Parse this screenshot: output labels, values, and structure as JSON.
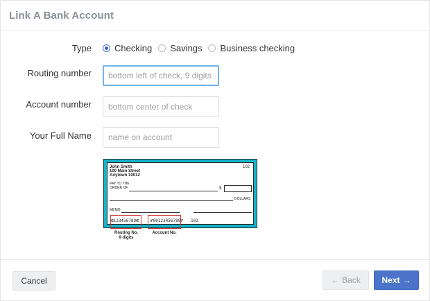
{
  "dialog": {
    "title": "Link A Bank Account"
  },
  "form": {
    "type_label": "Type",
    "type_options": [
      {
        "label": "Checking",
        "checked": true
      },
      {
        "label": "Savings",
        "checked": false
      },
      {
        "label": "Business checking",
        "checked": false
      }
    ],
    "routing_label": "Routing number",
    "routing_placeholder": "bottom left of check, 9 digits",
    "routing_value": "",
    "account_label": "Account number",
    "account_placeholder": "bottom center of check",
    "account_value": "",
    "name_label": "Your Full Name",
    "name_placeholder": "name on account",
    "name_value": ""
  },
  "check_image": {
    "owner_name": "John Smith",
    "address_line1": "100 Main Street",
    "address_line2": "Anytown 10012",
    "check_number": "102",
    "pay_to_line1": "PAY TO THE",
    "pay_to_line2": "ORDER OF",
    "dollar_sign": "$",
    "dollars": "DOLLARS",
    "memo": "MEMO",
    "micr_routing": "⑆123456789⑆",
    "micr_account": "⑈00123456789⑈",
    "micr_check": "102",
    "routing_caption_line1": "Routing No.",
    "routing_caption_line2": "9 digits",
    "account_caption": "Account No."
  },
  "footer": {
    "cancel_label": "Cancel",
    "back_label": "Back",
    "back_icon": "←",
    "next_label": "Next",
    "next_icon": "→"
  },
  "colors": {
    "primary": "#4a73c9",
    "check_border": "#12b4c9",
    "highlight_red": "#d23c3c",
    "focus_ring": "#72b3e6"
  }
}
